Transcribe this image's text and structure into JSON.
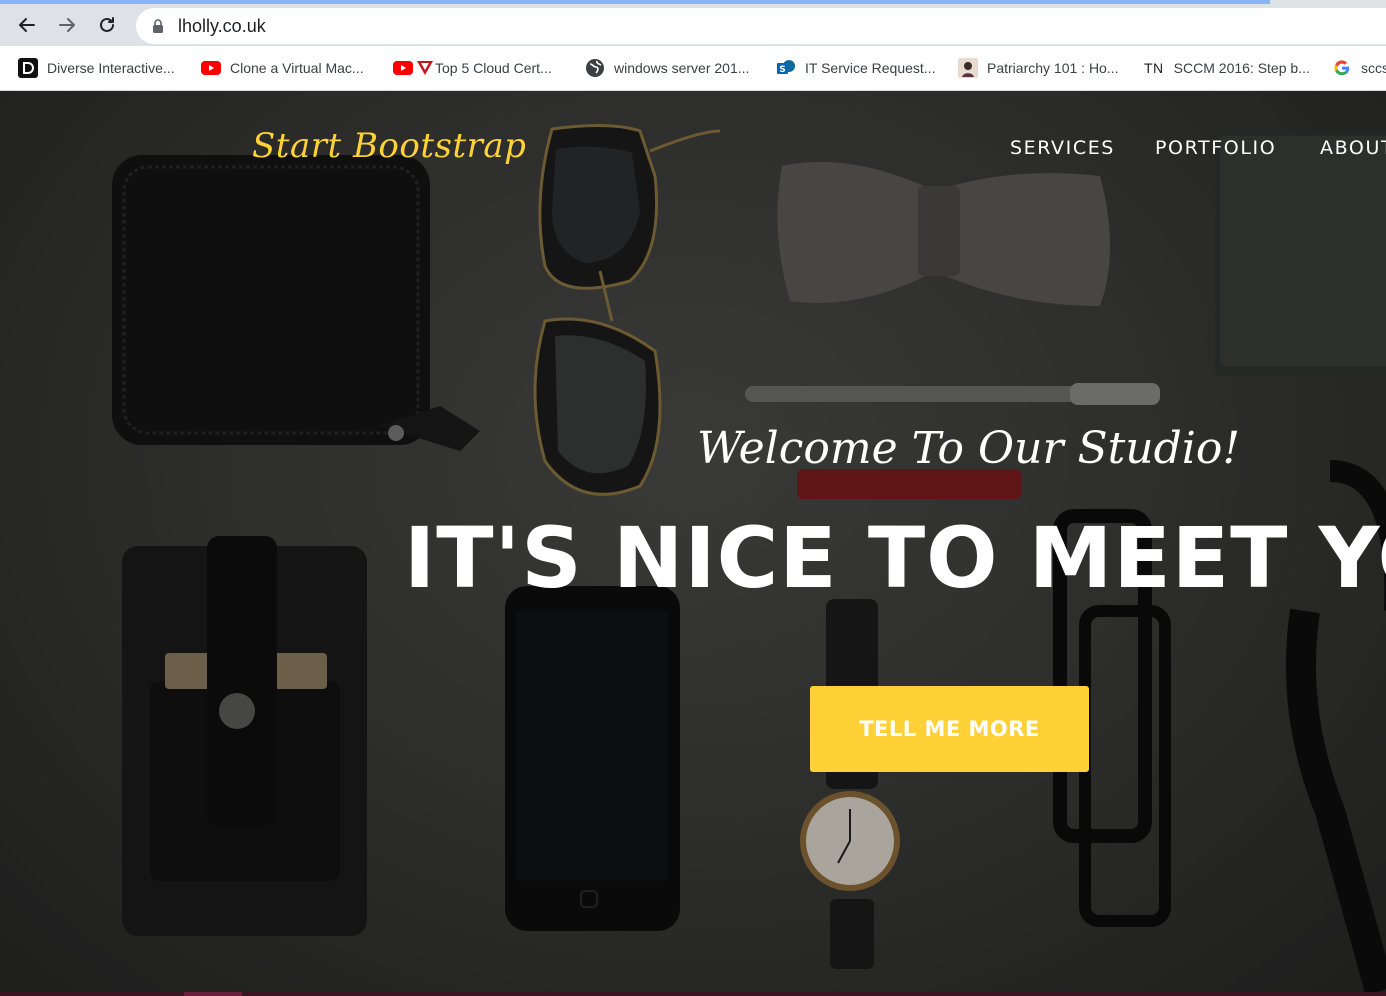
{
  "browser": {
    "url": "lholly.co.uk",
    "bookmarks": [
      {
        "label": "Diverse Interactive...",
        "icon": "d-logo-icon"
      },
      {
        "label": "Clone a Virtual Mac...",
        "icon": "youtube-icon"
      },
      {
        "label": "Top 5 Cloud Cert...",
        "icon": "red-triangle-icon"
      },
      {
        "label": "windows server 201...",
        "icon": "globe-icon"
      },
      {
        "label": "IT Service Request...",
        "icon": "sharepoint-icon"
      },
      {
        "label": "Patriarchy 101 : Ho...",
        "icon": "avatar-icon"
      },
      {
        "label": "SCCM 2016: Step b...",
        "icon": "tn-icon",
        "prefix": "TN"
      },
      {
        "label": "sccs",
        "icon": "google-icon"
      }
    ]
  },
  "site": {
    "brand": "Start Bootstrap",
    "nav": [
      "SERVICES",
      "PORTFOLIO",
      "ABOUT"
    ],
    "welcome": "Welcome To Our Studio!",
    "headline": "IT'S NICE TO MEET YOU",
    "cta": "TELL ME MORE"
  },
  "colors": {
    "accent": "#fed136",
    "tab_accent": "#8ab4f8",
    "youtube": "#ff0000"
  }
}
